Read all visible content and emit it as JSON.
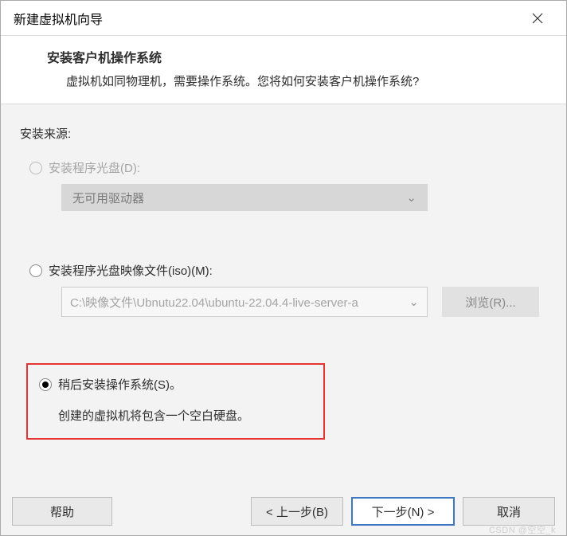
{
  "window": {
    "title": "新建虚拟机向导"
  },
  "header": {
    "title": "安装客户机操作系统",
    "description": "虚拟机如同物理机，需要操作系统。您将如何安装客户机操作系统?"
  },
  "content": {
    "source_label": "安装来源:",
    "options": {
      "disc": {
        "label": "安装程序光盘(D):",
        "dropdown_value": "无可用驱动器"
      },
      "iso": {
        "label": "安装程序光盘映像文件(iso)(M):",
        "path": "C:\\映像文件\\Ubnutu22.04\\ubuntu-22.04.4-live-server-a",
        "browse_button": "浏览(R)..."
      },
      "later": {
        "label": "稍后安装操作系统(S)。",
        "description": "创建的虚拟机将包含一个空白硬盘。"
      }
    }
  },
  "buttons": {
    "help": "帮助",
    "back": "< 上一步(B)",
    "next": "下一步(N) >",
    "cancel": "取消"
  },
  "watermark": "CSDN @空空_k"
}
